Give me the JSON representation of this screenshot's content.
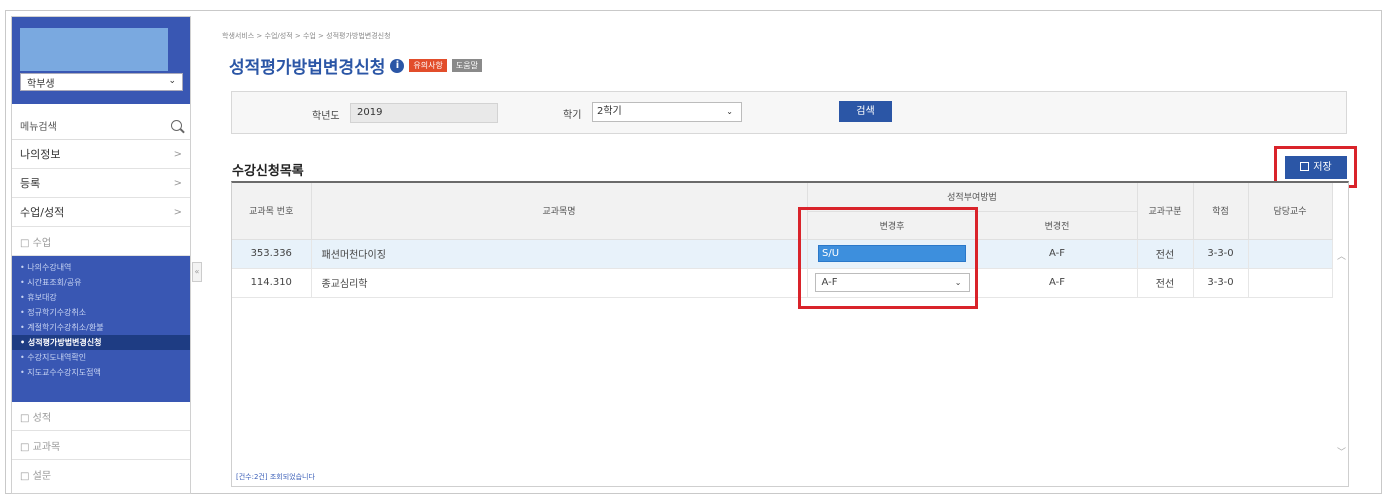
{
  "sidebar": {
    "role_select": "학부생",
    "menu_search_label": "메뉴검색",
    "items": [
      {
        "label": "나의정보"
      },
      {
        "label": "등록"
      },
      {
        "label": "수업/성적"
      }
    ],
    "sub_header": "□ 수업",
    "sub_links": [
      "• 나의수강내역",
      "• 시간표조회/공유",
      "• 휴보대강",
      "• 정규학기수강취소",
      "• 계절학기수강취소/환불",
      "• 성적평가방법변경신청",
      "• 수강지도내역확인",
      "• 지도교수수강지도점액"
    ],
    "bottom_items": [
      "□ 성적",
      "□ 교과목",
      "□ 설문"
    ]
  },
  "breadcrumb": "학생서비스 > 수업/성적 > 수업 > 성적평가방법변경신청",
  "page": {
    "title": "성적평가방법변경신청",
    "badge_notice": "유의사항",
    "badge_help": "도움말"
  },
  "search": {
    "year_label": "학년도",
    "year_value": "2019",
    "term_label": "학기",
    "term_value": "2학기",
    "button": "검색"
  },
  "list": {
    "title": "수강신청목록",
    "save_button": "저장",
    "headers": {
      "code": "교과목 번호",
      "name": "교과목명",
      "method_group": "성적부여방법",
      "after": "변경후",
      "before": "변경전",
      "category": "교과구분",
      "credit": "학점",
      "professor": "담당교수"
    },
    "rows": [
      {
        "code": "353.336",
        "name": "패션머천다이징",
        "after": "S/U",
        "before": "A-F",
        "category": "전선",
        "credit": "3-3-0",
        "professor": ""
      },
      {
        "code": "114.310",
        "name": "종교심리학",
        "after": "A-F",
        "before": "A-F",
        "category": "전선",
        "credit": "3-3-0",
        "professor": ""
      }
    ],
    "footer": "[건수:2건] 조회되었습니다"
  },
  "colors": {
    "primary": "#2b56a6",
    "sidebar": "#3957b3",
    "highlight_box": "#d9232a"
  }
}
